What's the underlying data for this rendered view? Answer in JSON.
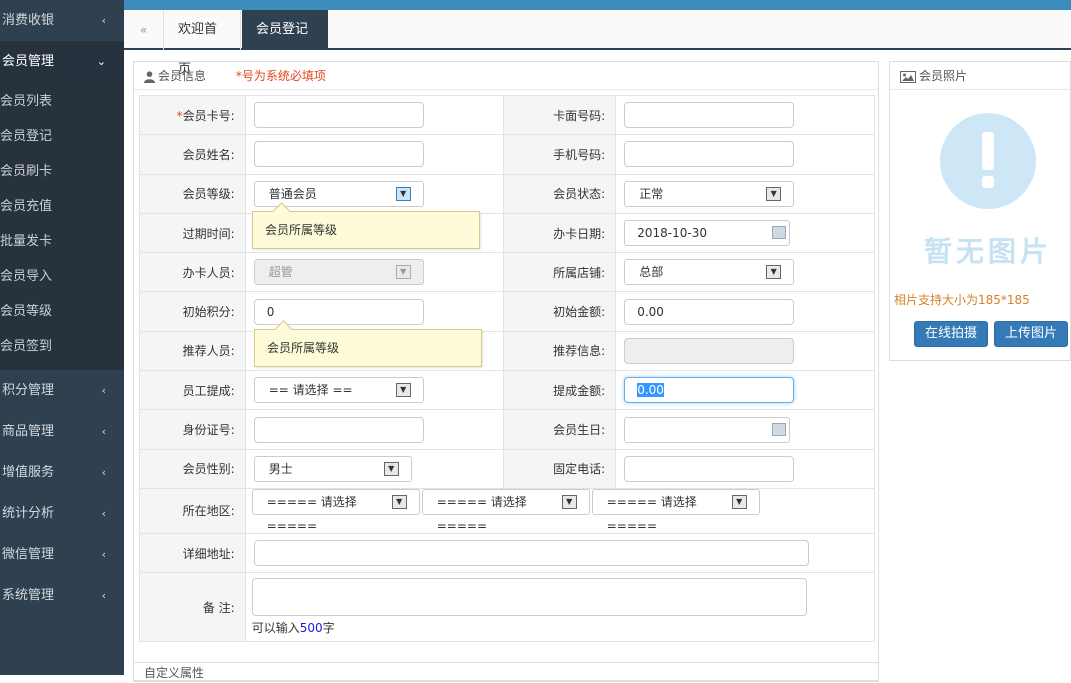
{
  "sidebar": {
    "items": [
      {
        "label": "消费收银",
        "chevron": "‹"
      },
      {
        "label": "会员管理",
        "chevron": "⌄"
      }
    ],
    "subitems": [
      "会员列表",
      "会员登记",
      "会员刷卡",
      "会员充值",
      "批量发卡",
      "会员导入",
      "会员等级",
      "会员签到"
    ],
    "items_after": [
      {
        "label": "积分管理",
        "chevron": "‹"
      },
      {
        "label": "商品管理",
        "chevron": "‹"
      },
      {
        "label": "增值服务",
        "chevron": "‹"
      },
      {
        "label": "统计分析",
        "chevron": "‹"
      },
      {
        "label": "微信管理",
        "chevron": "‹"
      },
      {
        "label": "系统管理",
        "chevron": "‹"
      }
    ]
  },
  "tabs": {
    "back_icon": "«",
    "home": "欢迎首页",
    "active": "会员登记",
    "close": "✖"
  },
  "form": {
    "title": "会员信息",
    "required_note": "*号为系统必填项",
    "required_star": "*",
    "labels": {
      "card_no": "会员卡号:",
      "face_no": "卡面号码:",
      "name": "会员姓名:",
      "phone": "手机号码:",
      "level": "会员等级:",
      "status": "会员状态:",
      "expire": "过期时间:",
      "issue_date": "办卡日期:",
      "operator": "办卡人员:",
      "store": "所属店铺:",
      "init_points": "初始积分:",
      "init_amount": "初始金额:",
      "referrer": "推荐人员:",
      "referral_info": "推荐信息:",
      "staff_commission": "员工提成:",
      "commission_amount": "提成金额:",
      "id_no": "身份证号:",
      "birthday": "会员生日:",
      "gender": "会员性别:",
      "landline": "固定电话:",
      "region": "所在地区:",
      "address": "详细地址:",
      "remark": "备 注:"
    },
    "values": {
      "level": "普通会员",
      "status": "正常",
      "issue_date": "2018-10-30",
      "operator": "超管",
      "store": "总部",
      "init_points": "0",
      "init_amount": "0.00",
      "staff_commission": "== 请选择 ==",
      "commission_amount": "0.00",
      "gender": "男士",
      "region1": "===== 请选择 =====",
      "region2": "===== 请选择 =====",
      "region3": "===== 请选择 ====="
    },
    "tooltip1": "会员所属等级",
    "tooltip2": "会员所属等级",
    "remark_hint_pre": "可以输入",
    "remark_hint_num": "500",
    "remark_hint_post": "字"
  },
  "photo": {
    "title": "会员照片",
    "no_image": "暂无图片",
    "hint": "相片支持大小为185*185",
    "btn_capture": "在线拍摄",
    "btn_upload": "上传图片"
  },
  "bottom": {
    "title": "自定义属性"
  },
  "colors": {
    "sidebar": "#2f4050",
    "accent": "#3c8dbc",
    "button": "#337ab7",
    "required": "#e2471d"
  }
}
